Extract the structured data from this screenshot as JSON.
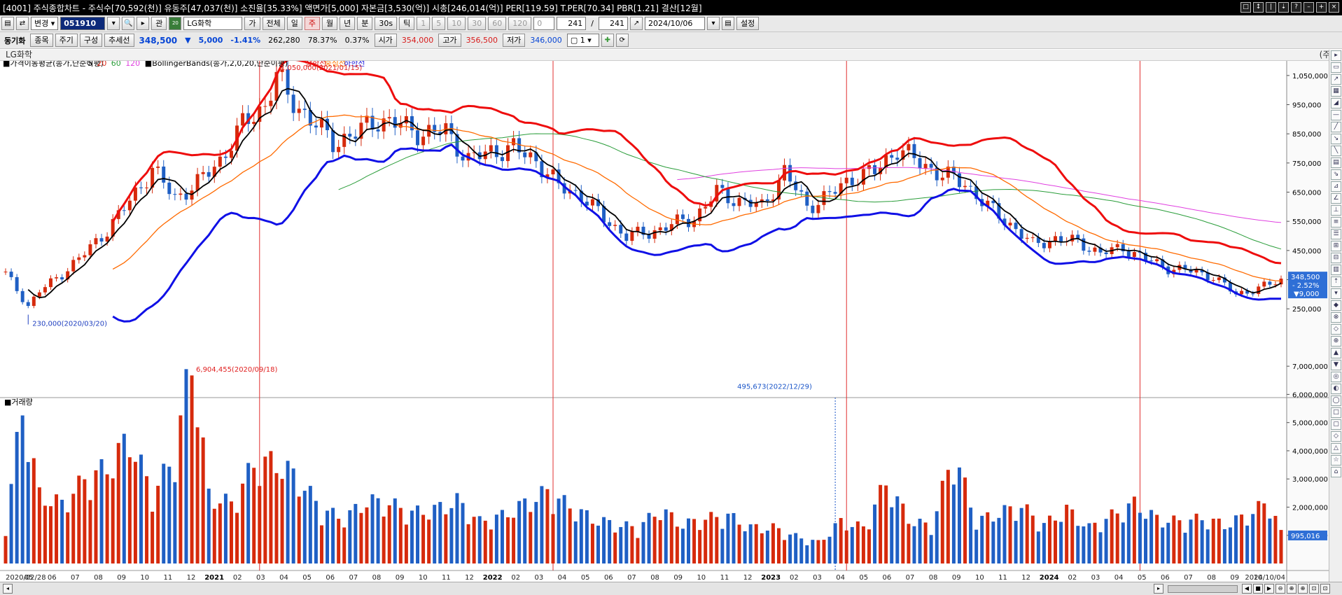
{
  "window": {
    "title": "[4001] 주식종합차트 - 주식수[70,592(천)] 유동주[47,037(천)] 소진율[35.33%] 액면가[5,000] 자본금[3,530(억)] 시총[246,014(억)] PER[119.59] T.PER[70.34] PBR[1.21] 결산[12월]"
  },
  "toolbar": {
    "change_label": "변경",
    "code": "051910",
    "gwan_label": "관",
    "stock_name": "LG화학",
    "ga_label": "가",
    "all_label": "전체",
    "periods": [
      "일",
      "주",
      "월",
      "년",
      "분",
      "30s",
      "틱"
    ],
    "counts": [
      "1",
      "5",
      "10",
      "30",
      "60",
      "120"
    ],
    "zero": "0",
    "count_a": "241",
    "slash": "/",
    "count_b": "241",
    "date": "2024/10/06",
    "settings_label": "설정"
  },
  "quote": {
    "sync_label": "동기화",
    "stock_btn": "종목",
    "period_btn": "주기",
    "config_btn": "구성",
    "trend_btn": "추세선",
    "price": "348,500",
    "arrow": "▼",
    "change": "5,000",
    "rate": "-1.41%",
    "volume": "262,280",
    "v2": "78.37%",
    "v3": "0.37%",
    "open_label": "시가",
    "open": "354,000",
    "high_label": "고가",
    "high": "356,500",
    "low_label": "저가",
    "low": "346,000",
    "mult": "1"
  },
  "namebar": {
    "name": "LG화학",
    "unit": "(주)"
  },
  "colors": {
    "up": "#d62a0c",
    "down": "#1f5fc4",
    "ma5": "#000000",
    "ma20": "#ff6a00",
    "ma60": "#2a9d3a",
    "ma120": "#e040e0",
    "bb_upper": "#ee0d0d",
    "bb_lower": "#1010e6"
  },
  "chart_data": {
    "type": "candlestick",
    "legend": {
      "ma_title": "가격이동평균(종가,단순이평)",
      "ma_periods": [
        "5",
        "20",
        "60",
        "120"
      ],
      "bb_title": "BollingerBands(종가,2,0,20,단순이평)",
      "bb_upper": "상한선",
      "bb_mid": "중심선",
      "bb_lower": "하한선"
    },
    "y_ticks": [
      "1,050,000",
      "950,000",
      "850,000",
      "750,000",
      "650,000",
      "550,000",
      "450,000",
      "350,000",
      "250,000"
    ],
    "y_values": [
      1050000,
      950000,
      850000,
      750000,
      650000,
      550000,
      450000,
      350000,
      250000
    ],
    "ylim": [
      200000,
      1100000
    ],
    "annotations": {
      "high": "1,050,000(2021/01/15)",
      "low": "230,000(2020/03/20)"
    },
    "current": {
      "price": "348,500",
      "rate": "- 2.52%",
      "change": "▼9,000"
    },
    "volume": {
      "title": "거래량",
      "y_ticks": [
        "7,000,000",
        "6,000,000",
        "5,000,000",
        "4,000,000",
        "3,000,000",
        "2,000,000",
        "1,000,000"
      ],
      "ylim": [
        0,
        7600000
      ],
      "max_label": "6,904,455(2020/09/18)",
      "mark_label": "495,673(2022/12/29)",
      "last": "995,016"
    },
    "x_labels": [
      "2020/02/28",
      "05",
      "06",
      "07",
      "08",
      "09",
      "10",
      "11",
      "12",
      "2021",
      "02",
      "03",
      "04",
      "05",
      "06",
      "07",
      "08",
      "09",
      "10",
      "11",
      "12",
      "2022",
      "02",
      "03",
      "04",
      "05",
      "06",
      "07",
      "08",
      "09",
      "10",
      "11",
      "12",
      "2023",
      "02",
      "03",
      "04",
      "05",
      "06",
      "07",
      "08",
      "09",
      "10",
      "11",
      "12",
      "2024",
      "02",
      "03",
      "04",
      "05",
      "06",
      "07",
      "08",
      "09",
      "10",
      "2024/10/04"
    ],
    "price_key": [
      [
        0,
        370000
      ],
      [
        4,
        260000
      ],
      [
        6,
        310000
      ],
      [
        10,
        370000
      ],
      [
        14,
        440000
      ],
      [
        18,
        520000
      ],
      [
        22,
        620000
      ],
      [
        26,
        730000
      ],
      [
        30,
        630000
      ],
      [
        34,
        680000
      ],
      [
        38,
        760000
      ],
      [
        42,
        880000
      ],
      [
        46,
        950000
      ],
      [
        48,
        1050000
      ],
      [
        50,
        980000
      ],
      [
        54,
        900000
      ],
      [
        58,
        820000
      ],
      [
        62,
        850000
      ],
      [
        66,
        900000
      ],
      [
        70,
        880000
      ],
      [
        74,
        850000
      ],
      [
        78,
        860000
      ],
      [
        82,
        760000
      ],
      [
        86,
        790000
      ],
      [
        90,
        800000
      ],
      [
        94,
        760000
      ],
      [
        98,
        670000
      ],
      [
        102,
        640000
      ],
      [
        106,
        560000
      ],
      [
        110,
        500000
      ],
      [
        114,
        510000
      ],
      [
        118,
        540000
      ],
      [
        122,
        560000
      ],
      [
        126,
        650000
      ],
      [
        130,
        620000
      ],
      [
        134,
        600000
      ],
      [
        138,
        720000
      ],
      [
        142,
        600000
      ],
      [
        146,
        640000
      ],
      [
        150,
        700000
      ],
      [
        154,
        720000
      ],
      [
        158,
        800000
      ],
      [
        162,
        750000
      ],
      [
        166,
        710000
      ],
      [
        170,
        680000
      ],
      [
        174,
        600000
      ],
      [
        178,
        540000
      ],
      [
        182,
        470000
      ],
      [
        186,
        490000
      ],
      [
        190,
        480000
      ],
      [
        194,
        440000
      ],
      [
        198,
        460000
      ],
      [
        202,
        420000
      ],
      [
        206,
        390000
      ],
      [
        210,
        380000
      ],
      [
        214,
        360000
      ],
      [
        218,
        300000
      ],
      [
        222,
        320000
      ],
      [
        226,
        348500
      ]
    ],
    "volume_key": [
      [
        0,
        1300000
      ],
      [
        3,
        5200000
      ],
      [
        6,
        2300000
      ],
      [
        10,
        2000000
      ],
      [
        14,
        2800000
      ],
      [
        18,
        3200000
      ],
      [
        22,
        4200000
      ],
      [
        26,
        2300000
      ],
      [
        30,
        3600000
      ],
      [
        33,
        6904455
      ],
      [
        36,
        2300000
      ],
      [
        40,
        2000000
      ],
      [
        44,
        3300000
      ],
      [
        48,
        3400000
      ],
      [
        52,
        2800000
      ],
      [
        56,
        1800000
      ],
      [
        60,
        1500000
      ],
      [
        64,
        2100000
      ],
      [
        68,
        2000000
      ],
      [
        72,
        1700000
      ],
      [
        76,
        1800000
      ],
      [
        80,
        2100000
      ],
      [
        84,
        1400000
      ],
      [
        88,
        1600000
      ],
      [
        92,
        2000000
      ],
      [
        96,
        2400000
      ],
      [
        100,
        1900000
      ],
      [
        104,
        1500000
      ],
      [
        108,
        1300000
      ],
      [
        112,
        1200000
      ],
      [
        116,
        1800000
      ],
      [
        120,
        1300000
      ],
      [
        124,
        1500000
      ],
      [
        128,
        1600000
      ],
      [
        132,
        1200000
      ],
      [
        136,
        1200000
      ],
      [
        140,
        900000
      ],
      [
        144,
        700000
      ],
      [
        148,
        1400000
      ],
      [
        152,
        1200000
      ],
      [
        156,
        2700000
      ],
      [
        160,
        1500000
      ],
      [
        164,
        1200000
      ],
      [
        168,
        3700000
      ],
      [
        172,
        1400000
      ],
      [
        176,
        1700000
      ],
      [
        180,
        1900000
      ],
      [
        184,
        1300000
      ],
      [
        188,
        1800000
      ],
      [
        192,
        1200000
      ],
      [
        196,
        1600000
      ],
      [
        200,
        2000000
      ],
      [
        204,
        1500000
      ],
      [
        208,
        1400000
      ],
      [
        212,
        1500000
      ],
      [
        216,
        1300000
      ],
      [
        220,
        1600000
      ],
      [
        224,
        2100000
      ],
      [
        226,
        995016
      ]
    ]
  }
}
